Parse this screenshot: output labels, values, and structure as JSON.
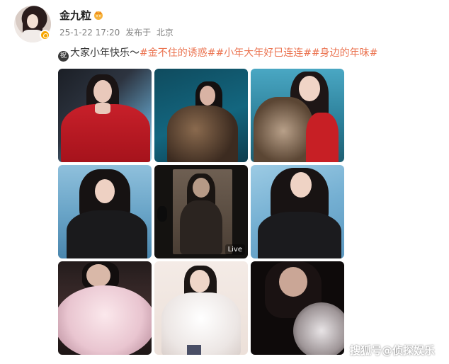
{
  "post": {
    "username": "金九粒",
    "crown_icon": "crown-icon",
    "verify_icon": "verified-badge-icon",
    "timestamp": "25-1-22 17:20",
    "source": "发布于",
    "location": "北京",
    "emoji_icon": "celebrate-emoji-icon",
    "emoji_text": "祝",
    "text": "大家小年快乐～",
    "hashtags": [
      "#金不住的诱惑#",
      "#小年大年好巳连连#",
      "#身边的年味#"
    ],
    "live_label": "Live",
    "watermark": "搜狐号@侦探娱乐"
  },
  "colors": {
    "tag": "#eb7350",
    "meta": "#808080",
    "username": "#222222"
  },
  "photos": [
    {
      "id": 1,
      "desc": "red-dress-photo"
    },
    {
      "id": 2,
      "desc": "fur-coat-teal-photo"
    },
    {
      "id": 3,
      "desc": "fur-coat-red-top-photo"
    },
    {
      "id": 4,
      "desc": "black-shirt-blue-bg-photo"
    },
    {
      "id": 5,
      "desc": "live-photo-dark"
    },
    {
      "id": 6,
      "desc": "black-top-blue-bg-photo"
    },
    {
      "id": 7,
      "desc": "pink-fur-photo"
    },
    {
      "id": 8,
      "desc": "white-fur-jacket-photo"
    },
    {
      "id": 9,
      "desc": "dark-fur-photo"
    }
  ]
}
